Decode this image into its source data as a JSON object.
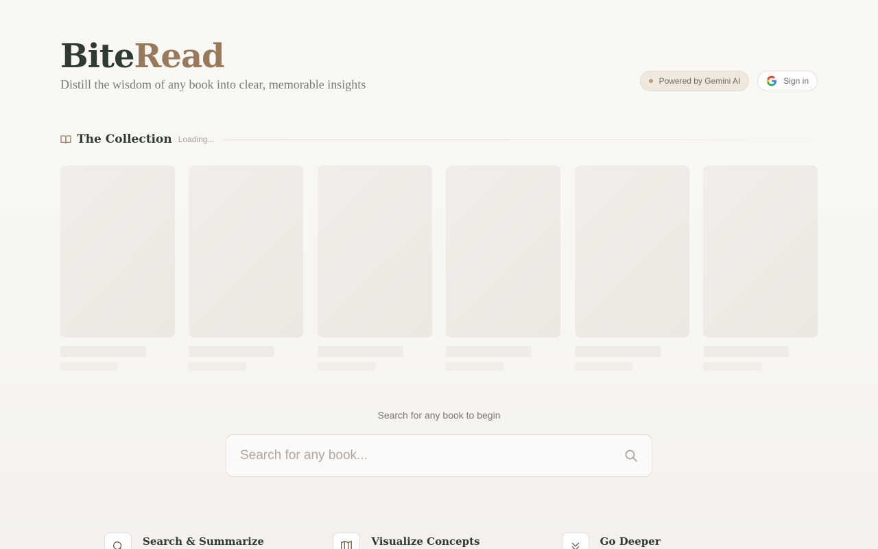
{
  "header": {
    "logo_part1": "Bite",
    "logo_part2": "Read",
    "tagline": "Distill the wisdom of any book into clear, memorable insights",
    "gemini_badge": "Powered by Gemini AI",
    "signin_label": "Sign in"
  },
  "collection": {
    "title": "The Collection",
    "status": "Loading...",
    "placeholder_cards": 6
  },
  "search": {
    "hint": "Search for any book to begin",
    "placeholder": "Search for any book..."
  },
  "features": [
    {
      "title": "Search & Summarize",
      "icon": "search-icon"
    },
    {
      "title": "Visualize Concepts",
      "icon": "map-icon"
    },
    {
      "title": "Go Deeper",
      "icon": "chevrons-down-icon"
    }
  ],
  "colors": {
    "brand_dark": "#2f3b32",
    "brand_accent": "#967a5b",
    "background": "#faf8f5"
  }
}
